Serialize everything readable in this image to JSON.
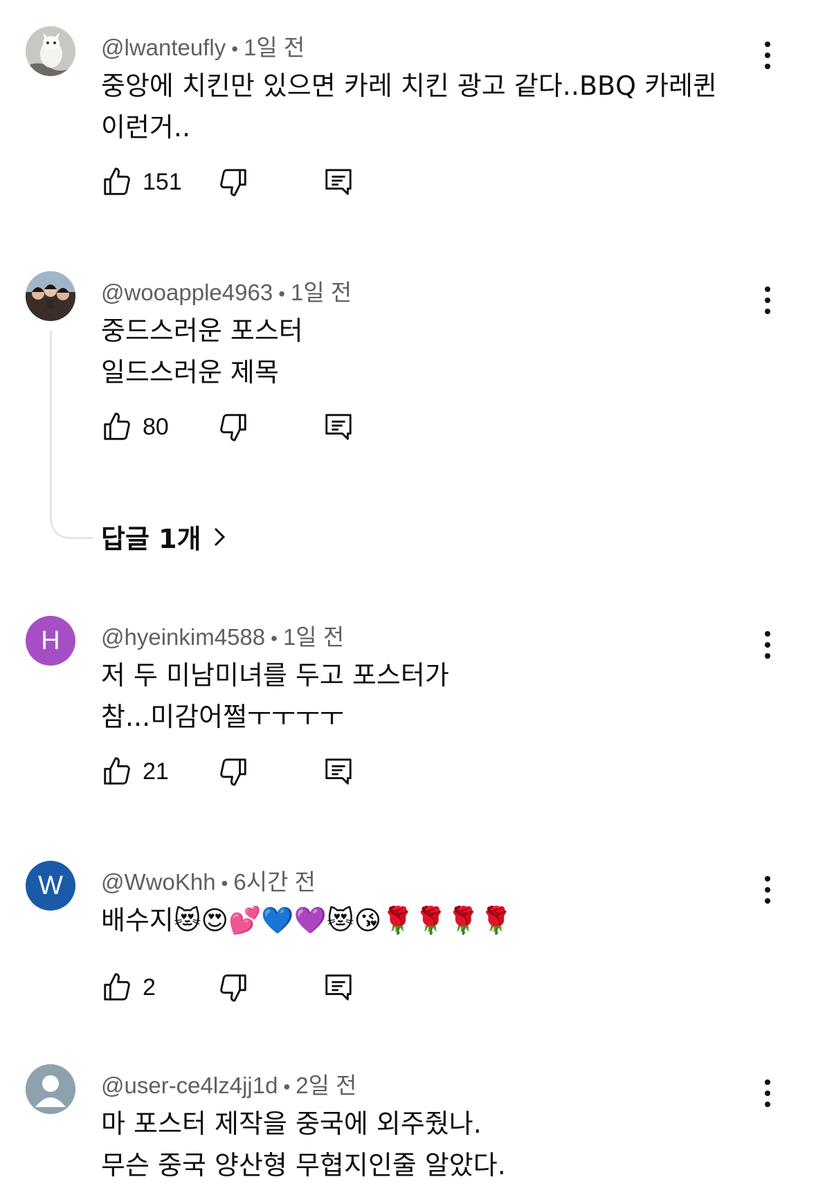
{
  "comments": [
    {
      "handle": "@lwanteufly",
      "time": "1일 전",
      "lines": [
        "중앙에 치킨만 있으면 카레 치킨 광고 같다..BBQ 카레퀸",
        "이런거.."
      ],
      "likes": "151",
      "avatar": {
        "type": "photo",
        "description_icon": "owl-avatar-icon",
        "bg": "#c9c7c2"
      }
    },
    {
      "handle": "@wooapple4963",
      "time": "1일 전",
      "lines": [
        "중드스러운 포스터",
        "일드스러운 제목"
      ],
      "likes": "80",
      "avatar": {
        "type": "photo",
        "description_icon": "group-photo-avatar-icon",
        "bg": "#5b4a44"
      },
      "replies": "답글 1개"
    },
    {
      "handle": "@hyeinkim4588",
      "time": "1일 전",
      "lines": [
        "저 두 미남미녀를 두고 포스터가",
        "참...미감어쩔ㅜㅜㅜㅜ"
      ],
      "likes": "21",
      "avatar": {
        "type": "letter",
        "letter": "H",
        "bg": "#a64fc4"
      }
    },
    {
      "handle": "@WwoKhh",
      "time": "6시간 전",
      "lines": [
        "배수지😻😍💕💙💜😻😘🌹🌹🌹🌹"
      ],
      "likes": "2",
      "avatar": {
        "type": "letter",
        "letter": "W",
        "bg": "#1a5aa8"
      }
    },
    {
      "handle": "@user-ce4lz4jj1d",
      "time": "2일 전",
      "lines": [
        "마 포스터 제작을 중국에 외주줬나.",
        "무슨 중국 양산형 무협지인줄 알았다."
      ],
      "avatar": {
        "type": "default",
        "bg": "#8ea2ae"
      }
    }
  ],
  "icons": {
    "like": "thumbs-up-icon",
    "dislike": "thumbs-down-icon",
    "reply": "reply-comment-icon",
    "more": "vertical-ellipsis-icon",
    "chevron": "chevron-right-icon"
  }
}
